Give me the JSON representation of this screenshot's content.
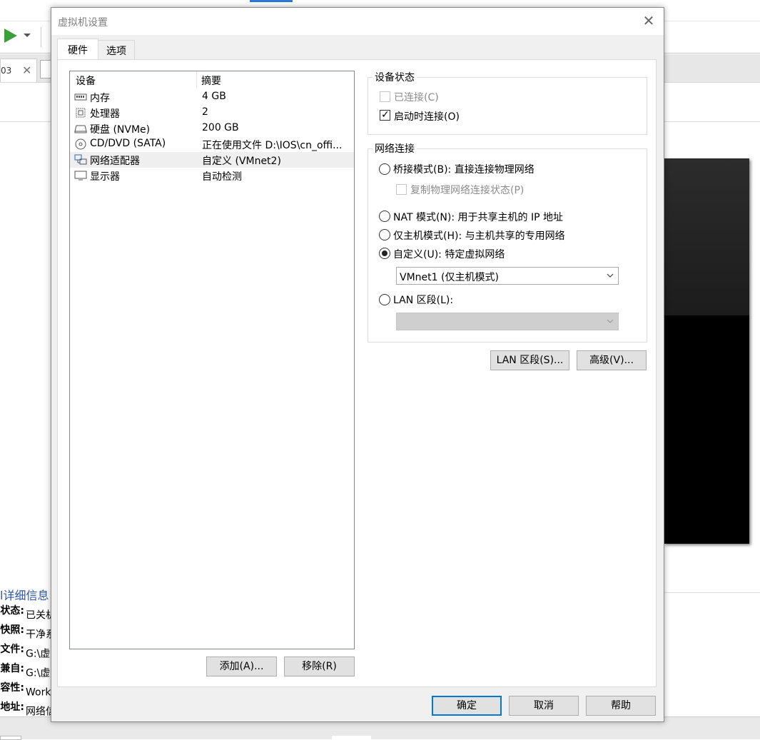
{
  "background": {
    "tab_label": "03",
    "details": {
      "title": "l详细信息",
      "rows": [
        {
          "key": "状态:",
          "value": "已关机"
        },
        {
          "key": "快照:",
          "value": "干净系"
        },
        {
          "key": "文件:",
          "value": "G:\\虚"
        },
        {
          "key": "兼自:",
          "value": "G:\\虚"
        },
        {
          "key": "容性:",
          "value": "Work"
        },
        {
          "key": "地址:",
          "value": "网络信"
        }
      ]
    }
  },
  "dialog": {
    "title": "虚拟机设置",
    "tabs": [
      "硬件",
      "选项"
    ],
    "device_list": {
      "headers": {
        "device": "设备",
        "summary": "摘要"
      },
      "rows": [
        {
          "icon": "memory-icon",
          "name": "内存",
          "summary": "4 GB"
        },
        {
          "icon": "processor-icon",
          "name": "处理器",
          "summary": "2"
        },
        {
          "icon": "hard-disk-icon",
          "name": "硬盘 (NVMe)",
          "summary": "200 GB"
        },
        {
          "icon": "cd-dvd-icon",
          "name": "CD/DVD (SATA)",
          "summary": "正在使用文件 D:\\IOS\\cn_offi..."
        },
        {
          "icon": "network-adapter-icon",
          "name": "网络适配器",
          "summary": "自定义 (VMnet2)"
        },
        {
          "icon": "display-icon",
          "name": "显示器",
          "summary": "自动检测"
        }
      ],
      "selected_index": 4
    },
    "buttons": {
      "add": "添加(A)...",
      "remove": "移除(R)",
      "ok": "确定",
      "cancel": "取消",
      "help": "帮助"
    },
    "device_status": {
      "title": "设备状态",
      "connected": {
        "label": "已连接(C)",
        "checked": false,
        "enabled": false
      },
      "connect_at_power_on": {
        "label": "启动时连接(O)",
        "checked": true,
        "enabled": true
      }
    },
    "network_connection": {
      "title": "网络连接",
      "bridged": {
        "label": "桥接模式(B): 直接连接物理网络",
        "selected": false
      },
      "replicate": {
        "label": "复制物理网络连接状态(P)",
        "checked": false,
        "enabled": false
      },
      "nat": {
        "label": "NAT 模式(N): 用于共享主机的 IP 地址",
        "selected": false
      },
      "host_only": {
        "label": "仅主机模式(H): 与主机共享的专用网络",
        "selected": false
      },
      "custom": {
        "label": "自定义(U): 特定虚拟网络",
        "selected": true
      },
      "custom_select_value": "VMnet1 (仅主机模式)",
      "lan_segment": {
        "label": "LAN 区段(L):",
        "selected": false
      },
      "lan_select_value": ""
    },
    "network_buttons": {
      "lan_segments": "LAN 区段(S)...",
      "advanced": "高级(V)..."
    }
  }
}
